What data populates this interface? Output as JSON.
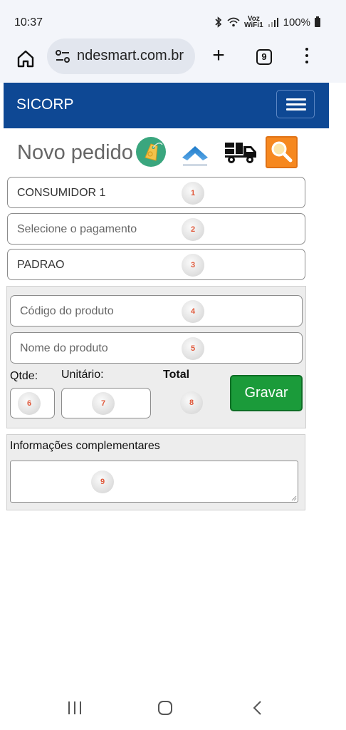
{
  "status_bar": {
    "time": "10:37",
    "network_top": "Voz",
    "network_bottom": "WiFi1",
    "battery": "100%"
  },
  "browser": {
    "url": "ndesmart.com.br",
    "tab_count": "9"
  },
  "app": {
    "title": "SICORP",
    "page_title": "Novo pedido"
  },
  "form": {
    "customer": {
      "value": "CONSUMIDOR 1",
      "badge": "1"
    },
    "payment": {
      "placeholder": "Selecione o pagamento",
      "badge": "2"
    },
    "price_table": {
      "value": "PADRAO",
      "badge": "3"
    },
    "product_code": {
      "placeholder": "Código do produto",
      "badge": "4"
    },
    "product_name": {
      "placeholder": "Nome do produto",
      "badge": "5"
    },
    "qty": {
      "label": "Qtde:",
      "badge": "6"
    },
    "unit_price": {
      "label": "Unitário:",
      "badge": "7"
    },
    "total": {
      "label": "Total",
      "badge": "8"
    },
    "save_label": "Gravar",
    "notes": {
      "label": "Informações complementares",
      "badge": "9"
    }
  },
  "colors": {
    "header": "#0e4894",
    "save_button": "#1b9b3a",
    "search_button": "#f6881f",
    "badge_number": "#e0583a"
  },
  "icons": {
    "toolbar": [
      "tag-icon",
      "chevron-up-icon",
      "truck-icon",
      "search-icon"
    ]
  }
}
